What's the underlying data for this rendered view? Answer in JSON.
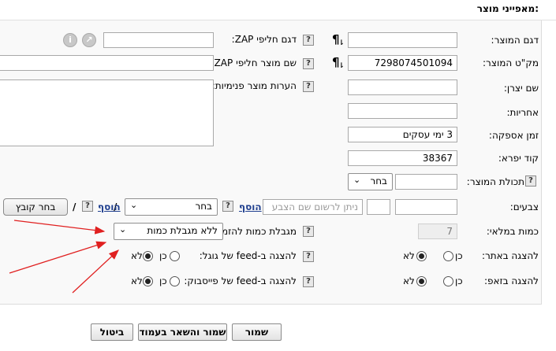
{
  "section": {
    "title": "מאפייני מוצר:"
  },
  "fields": {
    "model": {
      "label": "דגם המוצר:",
      "value": ""
    },
    "barcode": {
      "label": "מק\"ט המוצר:",
      "value": "7298074501094"
    },
    "manufacturer": {
      "label": "שם יצרן:",
      "value": ""
    },
    "warranty": {
      "label": "אחריות:",
      "value": ""
    },
    "supply_time": {
      "label": "זמן אספקה:",
      "value": "3 ימי עסקים"
    },
    "pharmacy_code": {
      "label": "קוד יפרא:",
      "value": "38367"
    },
    "product_content": {
      "label": "תכולת המוצר:",
      "select_value": "בחר",
      "value": ""
    },
    "colors": {
      "label": "צבעים:",
      "value1": "",
      "value2": ""
    },
    "stock_quantity": {
      "label": "כמות במלאי:",
      "value": "7"
    },
    "show_on_site": {
      "label": "להצגה באתר:",
      "opt_yes": "כן",
      "opt_no": "לא",
      "selected": "no"
    },
    "show_in_zap": {
      "label": "להצגה בזאפ:",
      "opt_yes": "כן",
      "opt_no": "לא",
      "selected": "no"
    },
    "zap_alt_model": {
      "label": "דגם חליפי ZAP:",
      "value": ""
    },
    "zap_alt_name": {
      "label": "שם מוצר חליפי ZAP:",
      "value": ""
    },
    "internal_notes": {
      "label": "הערות מוצר פנימיות:",
      "value": ""
    },
    "color_name": {
      "placeholder": "ניתן לרשום שם הצבע",
      "add_link": "הוסף",
      "select_value": "בחר",
      "separator": "/"
    },
    "file": {
      "button": "בחר קובץ",
      "add_link": "הוסף",
      "separator": "/"
    },
    "order_limit": {
      "label": "מגבלת כמות להזמנה:",
      "select_value": "ללא מגבלת כמות"
    },
    "google_feed": {
      "label": "להצגה ב-feed של גוגל:",
      "opt_yes": "כן",
      "opt_no": "לא",
      "selected": "no"
    },
    "facebook_feed": {
      "label": "להצגה ב-feed של פייסבוק:",
      "opt_yes": "כן",
      "opt_no": "לא",
      "selected": "no"
    }
  },
  "icons": {
    "help": "?",
    "pilcrow": "¶",
    "info": "i",
    "share": "↗",
    "chevron": "⌄"
  },
  "buttons": {
    "save": "שמור",
    "save_stay": "שמור והשאר בעמוד",
    "cancel": "ביטול"
  },
  "colors": {
    "arrow": "#e02020",
    "link": "#1f3f8f"
  }
}
